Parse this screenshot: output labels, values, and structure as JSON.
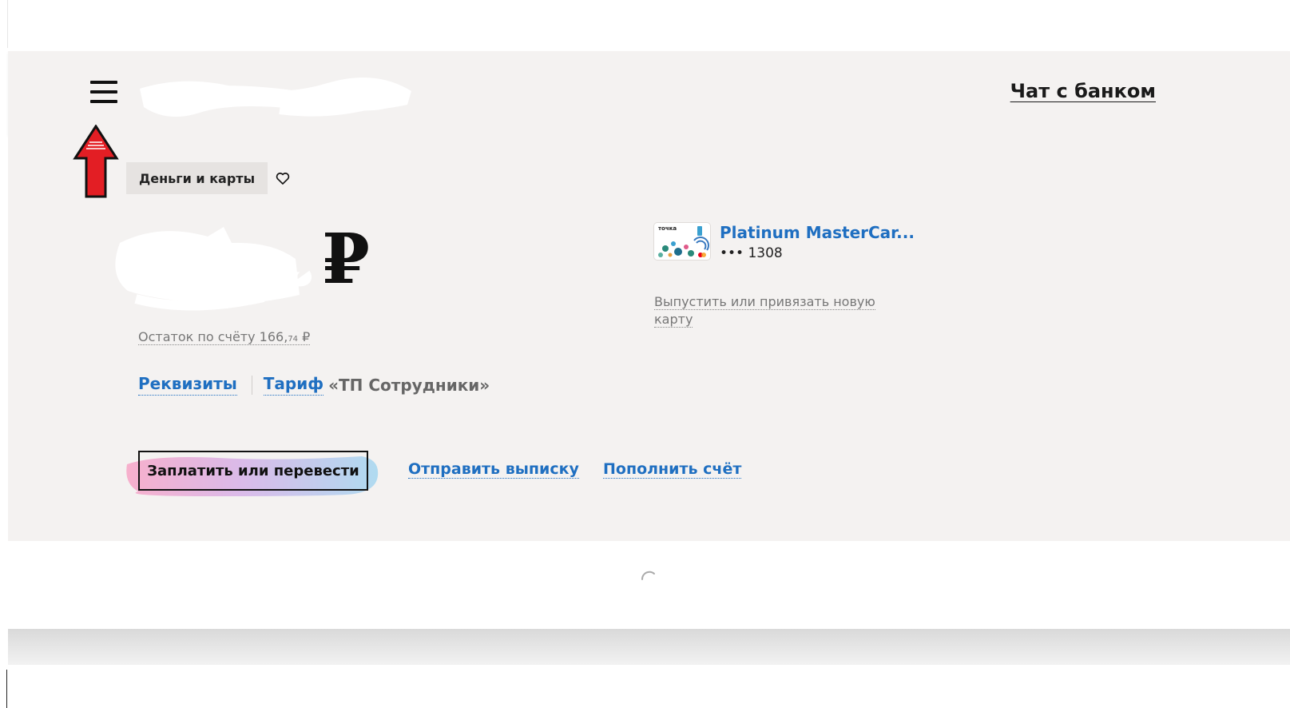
{
  "header": {
    "chat_label": "Чат с банком"
  },
  "breadcrumb": {
    "label": "Деньги и карты"
  },
  "balance": {
    "currency_symbol": "₽",
    "remaining_label": "Остаток по счёту 166,",
    "remaining_kopecks": "74",
    "remaining_currency": " ₽"
  },
  "account_links": {
    "requisites_label": "Реквизиты",
    "tariff_label": "Тариф",
    "tariff_name": "«ТП Сотрудники»"
  },
  "card": {
    "brand_text": "точка",
    "name": "Platinum MasterCar...",
    "number": "••• 1308",
    "issue_label": "Выпустить или привязать новую карту"
  },
  "actions": {
    "pay_label": "Заплатить или перевести",
    "statement_label": "Отправить выписку",
    "topup_label": "Пополнить счёт"
  },
  "colors": {
    "link_blue": "#1f6fc1",
    "panel_bg": "#f4f2f1",
    "arrow_red": "#e31e24"
  }
}
